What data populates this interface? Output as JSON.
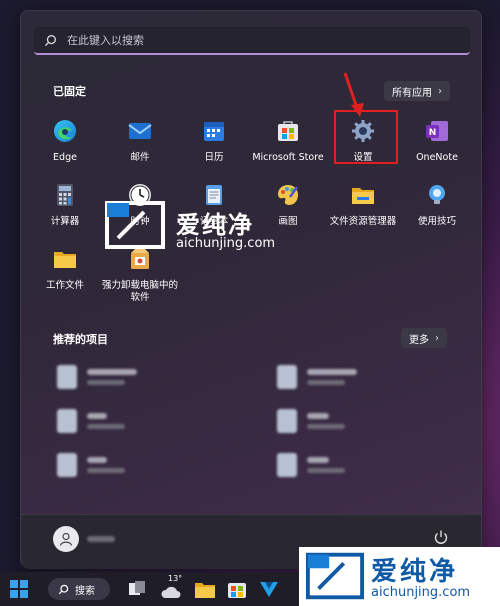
{
  "search": {
    "placeholder": "在此键入以搜索"
  },
  "pinned": {
    "title": "已固定",
    "all_apps_label": "所有应用",
    "apps": [
      {
        "name": "Edge"
      },
      {
        "name": "邮件"
      },
      {
        "name": "日历"
      },
      {
        "name": "Microsoft Store"
      },
      {
        "name": "设置"
      },
      {
        "name": "OneNote"
      },
      {
        "name": "计算器"
      },
      {
        "name": "时钟"
      },
      {
        "name": "记事本"
      },
      {
        "name": "画图"
      },
      {
        "name": "文件资源管理器"
      },
      {
        "name": "使用技巧"
      },
      {
        "name": "工作文件"
      },
      {
        "name": "强力卸载电脑中的软件"
      }
    ]
  },
  "recommended": {
    "title": "推荐的项目",
    "more_label": "更多"
  },
  "taskbar": {
    "search_label": "搜索",
    "weather_temp": "13°"
  },
  "watermark": {
    "brand": "爱纯净",
    "domain": "aichunjing.com"
  },
  "colors": {
    "highlight": "#e02020",
    "search_accent": "#b58cd6",
    "watermark_blue": "#0f5aa6"
  }
}
